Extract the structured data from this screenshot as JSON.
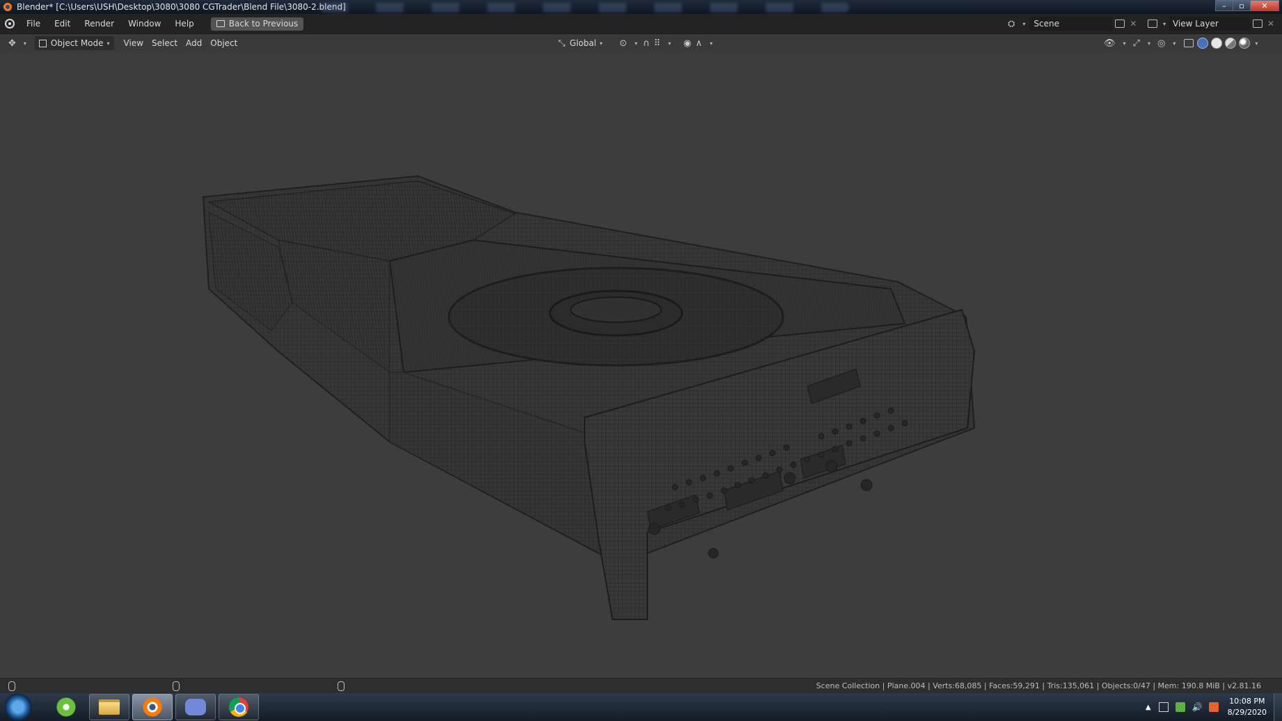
{
  "window": {
    "title": "Blender* [C:\\Users\\USH\\Desktop\\3080\\3080 CGTrader\\Blend File\\3080-2.blend]",
    "controls": [
      "–",
      "▫",
      "✕"
    ]
  },
  "topbar": {
    "menus": [
      "File",
      "Edit",
      "Render",
      "Window",
      "Help"
    ],
    "back_button": "Back to Previous",
    "scene_label": "Scene",
    "view_layer_label": "View Layer"
  },
  "viewport_header": {
    "mode": "Object Mode",
    "menus": [
      "View",
      "Select",
      "Add",
      "Object"
    ],
    "orientation": "Global"
  },
  "statusbar": {
    "stats": "Scene Collection | Plane.004 | Verts:68,085 | Faces:59,291 | Tris:135,061 | Objects:0/47 | Mem: 190.8 MiB | v2.81.16"
  },
  "taskbar": {
    "apps": [
      "utorrent-icon",
      "folder-icon",
      "blender-icon",
      "discord-icon",
      "chrome-icon"
    ],
    "time": "10:08 PM",
    "date": "8/29/2020"
  },
  "colors": {
    "viewport_bg": "#3d3d3d",
    "wire": "#1e1e1e",
    "accent": "#4772b3"
  }
}
